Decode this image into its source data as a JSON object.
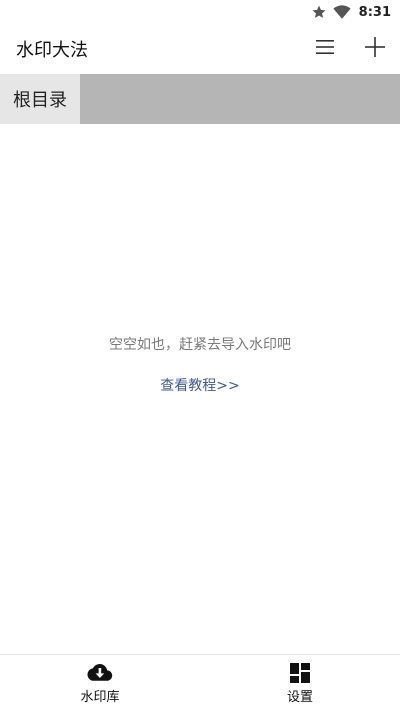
{
  "status_bar": {
    "time": "8:31",
    "icons": [
      "star-icon",
      "wifi-icon"
    ]
  },
  "app_bar": {
    "title": "水印大法",
    "actions": [
      {
        "name": "menu",
        "icon": "hamburger-menu-icon"
      },
      {
        "name": "add",
        "icon": "plus-icon"
      }
    ]
  },
  "breadcrumb": {
    "root_label": "根目录"
  },
  "empty_state": {
    "message": "空空如也，赶紧去导入水印吧",
    "tutorial_link": "查看教程>>"
  },
  "bottom_nav": {
    "items": [
      {
        "label": "水印库",
        "icon": "cloud-download-icon"
      },
      {
        "label": "设置",
        "icon": "dashboard-icon"
      }
    ]
  },
  "colors": {
    "breadcrumb_bg": "#b5b5b5",
    "breadcrumb_active_bg": "#e6e6e6",
    "link": "#3f5a92",
    "muted_text": "#7a7a7a"
  }
}
